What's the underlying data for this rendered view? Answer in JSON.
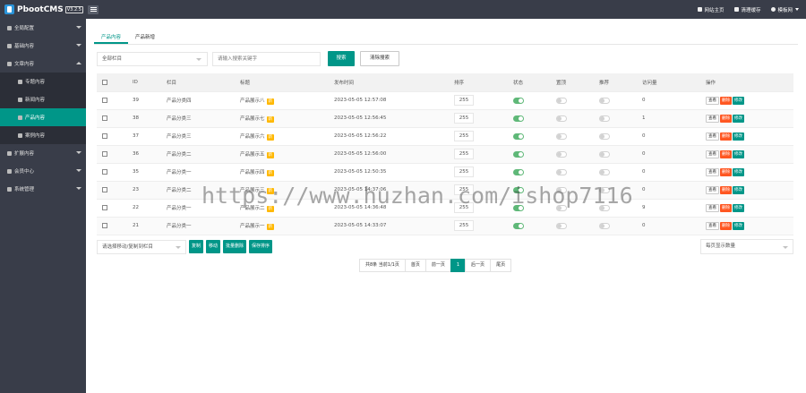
{
  "header": {
    "app_name": "PbootCMS",
    "version": "V3.2.5",
    "links": [
      {
        "label": "网站主页",
        "icon": "home-icon"
      },
      {
        "label": "清理缓存",
        "icon": "trash-icon"
      },
      {
        "label": "模板网",
        "icon": "user-icon"
      }
    ]
  },
  "sidebar": {
    "items": [
      {
        "label": "全局配置",
        "icon": "gear-icon"
      },
      {
        "label": "基础内容",
        "icon": "sliders-icon"
      },
      {
        "label": "文章内容",
        "icon": "file-icon"
      },
      {
        "label": "扩展内容",
        "icon": "puzzle-icon"
      },
      {
        "label": "会员中心",
        "icon": "user-icon"
      },
      {
        "label": "系统管理",
        "icon": "settings-icon"
      }
    ],
    "sub_items": [
      {
        "label": "专题内容"
      },
      {
        "label": "新闻内容"
      },
      {
        "label": "产品内容"
      },
      {
        "label": "案例内容"
      }
    ]
  },
  "tabs": [
    {
      "label": "产品内容"
    },
    {
      "label": "产品新增"
    }
  ],
  "filters": {
    "category_select": "全部栏目",
    "search_placeholder": "请输入搜索关键字",
    "search_button": "搜索",
    "clear_button": "清除搜索"
  },
  "table": {
    "headers": [
      "ID",
      "栏目",
      "标题",
      "发布时间",
      "排序",
      "状态",
      "置顶",
      "推荐",
      "访问量",
      "操作"
    ],
    "new_tag": "新",
    "actions": {
      "view": "查看",
      "delete": "删除",
      "edit": "修改"
    },
    "rows": [
      {
        "id": "39",
        "category": "产品分类四",
        "title": "产品展示八",
        "time": "2023-05-05 12:57:08",
        "sort": "255",
        "status": true,
        "top": false,
        "rec": false,
        "views": "0"
      },
      {
        "id": "38",
        "category": "产品分类三",
        "title": "产品展示七",
        "time": "2023-05-05 12:56:45",
        "sort": "255",
        "status": true,
        "top": false,
        "rec": false,
        "views": "1"
      },
      {
        "id": "37",
        "category": "产品分类三",
        "title": "产品展示六",
        "time": "2023-05-05 12:56:22",
        "sort": "255",
        "status": true,
        "top": false,
        "rec": false,
        "views": "0"
      },
      {
        "id": "36",
        "category": "产品分类二",
        "title": "产品展示五",
        "time": "2023-05-05 12:56:00",
        "sort": "255",
        "status": true,
        "top": false,
        "rec": false,
        "views": "0"
      },
      {
        "id": "35",
        "category": "产品分类一",
        "title": "产品展示四",
        "time": "2023-05-05 12:50:35",
        "sort": "255",
        "status": true,
        "top": false,
        "rec": false,
        "views": "0"
      },
      {
        "id": "23",
        "category": "产品分类二",
        "title": "产品展示三",
        "time": "2023-05-05 14:37:06",
        "sort": "255",
        "status": true,
        "top": false,
        "rec": false,
        "views": "0"
      },
      {
        "id": "22",
        "category": "产品分类一",
        "title": "产品展示二",
        "time": "2023-05-05 14:36:48",
        "sort": "255",
        "status": true,
        "top": false,
        "rec": false,
        "views": "9"
      },
      {
        "id": "21",
        "category": "产品分类一",
        "title": "产品展示一",
        "time": "2023-05-05 14:33:07",
        "sort": "255",
        "status": true,
        "top": false,
        "rec": false,
        "views": "0"
      }
    ]
  },
  "bottom": {
    "move_select": "请选择移动/复制到栏目",
    "buttons": [
      "复制",
      "移动",
      "批量删除",
      "保存排序"
    ],
    "per_page": "每页显示数量"
  },
  "pager": {
    "info": "共8条 当前1/1页",
    "first": "首页",
    "prev": "前一页",
    "current": "1",
    "next": "后一页",
    "last": "尾页"
  },
  "watermark": "https://www.huzhan.com/ishop7116",
  "colors": {
    "accent": "#009688",
    "danger": "#ff5722",
    "warning": "#ffb800",
    "sidebar": "#393d49"
  }
}
